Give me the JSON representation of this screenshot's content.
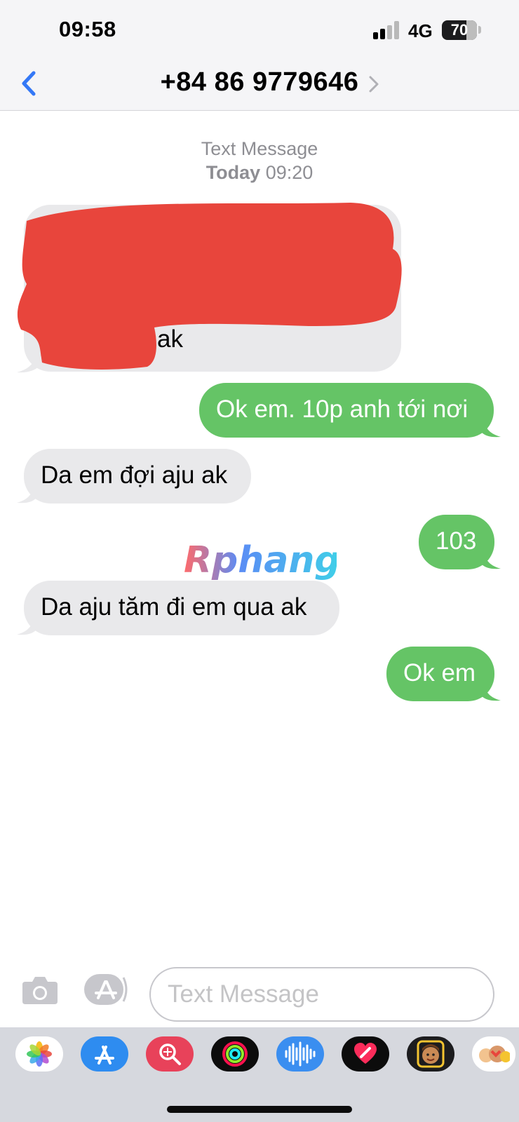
{
  "status_bar": {
    "time": "09:58",
    "network": "4G",
    "battery": "70",
    "battery_level": 0.7
  },
  "header": {
    "title": "+84 86 9779646"
  },
  "conversation": {
    "meta_label": "Text Message",
    "meta_date_day": "Today",
    "meta_date_time": "09:20",
    "messages": [
      {
        "direction": "incoming",
        "text": "ak",
        "redacted": true
      },
      {
        "direction": "outgoing",
        "text": "Ok em. 10p anh tới nơi"
      },
      {
        "direction": "incoming",
        "text": "Da em đợi aju ak"
      },
      {
        "direction": "outgoing",
        "text": "103"
      },
      {
        "direction": "incoming",
        "text": "Da aju tăm đi em qua ak"
      },
      {
        "direction": "outgoing",
        "text": "Ok em"
      }
    ]
  },
  "watermark": "Rphang",
  "input": {
    "placeholder": "Text Message"
  },
  "app_drawer": {
    "apps": [
      "photos-icon",
      "app-store-icon",
      "images-search-icon",
      "activity-icon",
      "audio-message-icon",
      "digital-touch-icon",
      "memoji-icon",
      "memoji-stickers-icon"
    ]
  },
  "colors": {
    "incoming": "#e9e9eb",
    "outgoing": "#65c466",
    "accent": "#3478f6",
    "redaction": "#e8453c"
  }
}
